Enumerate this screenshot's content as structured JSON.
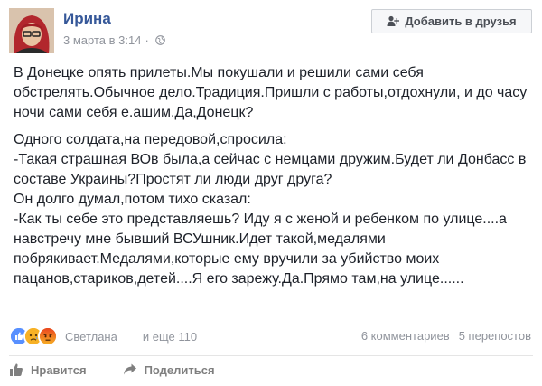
{
  "post": {
    "author": "Ирина",
    "timestamp": "3 марта в 3:14",
    "meta_separator": "·",
    "add_friend_label": "Добавить в друзья",
    "paragraphs": [
      "В Донецке опять прилеты.Мы покушали и решили сами себя обстрелять.Обычное дело.Традиция.Пришли с работы,отдохнули, и до часу ночи сами себя е.ашим.Да,Донецк?",
      "Одного солдата,на передовой,спросила:\n-Такая страшная ВОв была,а сейчас с немцами дружим.Будет ли Донбасс в составе Украины?Простят ли люди друг друга?\nОн долго думал,потом тихо сказал:\n-Как ты себе это представляешь? Иду я с женой и ребенком по улице....а навстречу мне бывший ВСУшник.Идет такой,медалями побрякивает.Медалями,которые ему вручили за убийство моих пацанов,стариков,детей....Я его зарежу.Да.Прямо там,на улице......"
    ],
    "reactions": {
      "icons": [
        "like-icon",
        "sad-icon",
        "angry-icon"
      ],
      "names": "Светлана",
      "more": "и еще 110"
    },
    "comments_count": "6 комментариев",
    "shares_count": "5 перепостов",
    "actions": {
      "like_label": "Нравится",
      "share_label": "Поделиться"
    }
  },
  "colors": {
    "link": "#365899",
    "meta": "#90949c",
    "like_blue": "#5890ff",
    "sad_yellow": "#f7b125",
    "angry_red": "#e9710f"
  }
}
